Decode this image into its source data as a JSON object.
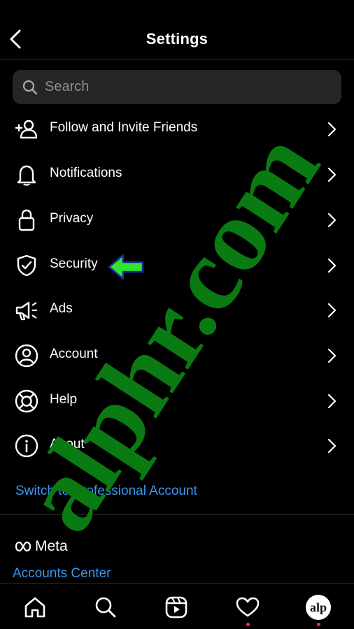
{
  "header": {
    "title": "Settings"
  },
  "search": {
    "placeholder": "Search"
  },
  "menu": [
    {
      "label": "Follow and Invite Friends",
      "icon": "add-person-icon"
    },
    {
      "label": "Notifications",
      "icon": "bell-icon"
    },
    {
      "label": "Privacy",
      "icon": "lock-icon"
    },
    {
      "label": "Security",
      "icon": "shield-check-icon"
    },
    {
      "label": "Ads",
      "icon": "megaphone-icon"
    },
    {
      "label": "Account",
      "icon": "user-circle-icon"
    },
    {
      "label": "Help",
      "icon": "lifebuoy-icon"
    },
    {
      "label": "About",
      "icon": "info-icon"
    }
  ],
  "switch_link": "Switch to Professional Account",
  "meta": {
    "logo_text": "Meta",
    "accounts_center": "Accounts Center"
  },
  "bottom_nav": {
    "items": [
      "home-icon",
      "search-icon",
      "reels-icon",
      "heart-icon",
      "profile-avatar"
    ],
    "avatar_text": "alp"
  },
  "watermark": {
    "text": "alphr.com",
    "color": "#0a7a12"
  },
  "colors": {
    "background": "#000000",
    "link": "#3797f0",
    "divider": "#262626",
    "annotation_arrow": "#2ee62e"
  }
}
